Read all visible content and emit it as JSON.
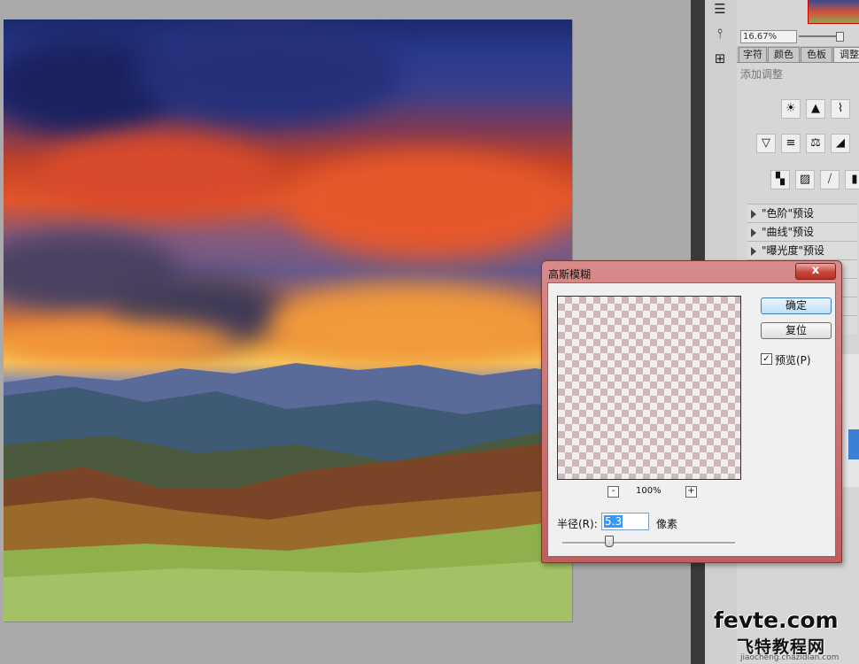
{
  "tool_icons": [
    "adjust-sliders-icon",
    "usb-icon",
    "clone-source-icon"
  ],
  "navigator": {
    "zoom": "16.67%",
    "thumbnail": "navigator-thumbnail"
  },
  "panel_tabs": [
    {
      "label": "字符",
      "active": false
    },
    {
      "label": "颜色",
      "active": false
    },
    {
      "label": "色板",
      "active": false
    },
    {
      "label": "调整",
      "active": true
    }
  ],
  "adjustments": {
    "title": "添加调整",
    "row1": [
      "brightness-icon",
      "levels-icon",
      "curves-icon"
    ],
    "row2": [
      "vibrance-icon",
      "hue-saturation-icon",
      "color-balance-icon",
      "black-white-icon"
    ],
    "row3": [
      "channel-mixer-icon",
      "gradient-map-icon",
      "selective-color-icon",
      "threshold-icon"
    ],
    "presets": [
      "\"色阶\"预设",
      "\"曲线\"预设",
      "\"曝光度\"预设"
    ]
  },
  "dialog": {
    "title": "高斯模糊",
    "close_label": "x",
    "ok_label": "确定",
    "reset_label": "复位",
    "preview_label": "预览(P)",
    "preview_checked": true,
    "zoom_out": "-",
    "zoom_in": "+",
    "zoom_value": "100%",
    "radius_label": "半径(R):",
    "radius_value": "5.3",
    "unit": "像素"
  },
  "watermark": {
    "main": "fevte.com",
    "cn": "飞特教程网",
    "url": "jiaocheng.chazidian.com"
  },
  "colors": {
    "dialog_frame": "#c55c5c",
    "accent_blue": "#3399ff"
  }
}
